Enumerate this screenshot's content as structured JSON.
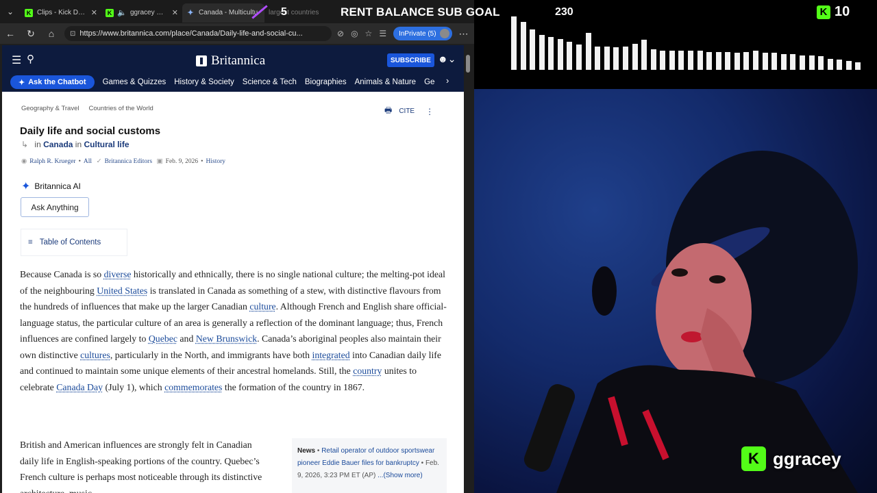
{
  "browser": {
    "tabs": [
      {
        "title": "Clips - Kick Dashbo",
        "icon": "kick-icon"
      },
      {
        "title": "ggracey Stream",
        "icon": "speaker-icon"
      },
      {
        "title": "Canada - Multicultu",
        "icon": "britannica-icon"
      },
      {
        "title": "largest countries",
        "icon": "page-icon"
      }
    ],
    "url": "https://www.britannica.com/place/Canada/Daily-life-and-social-cu...",
    "inprivate_label": "InPrivate (5)"
  },
  "site": {
    "logo": "Britannica",
    "subscribe": "SUBSCRIBE",
    "chatbot": "Ask the Chatbot",
    "nav": [
      "Games & Quizzes",
      "History & Society",
      "Science & Tech",
      "Biographies",
      "Animals & Nature",
      "Geography & Travel"
    ]
  },
  "article": {
    "breadcrumbs": [
      "Geography & Travel",
      "Countries of the World"
    ],
    "cite": "CITE",
    "title": "Daily life and social customs",
    "in_word_1": "in",
    "in_link_1": "Canada",
    "in_word_2": "in",
    "in_link_2": "Cultural life",
    "author": "Ralph R. Krueger",
    "all": "All",
    "editors": "Britannica Editors",
    "date": "Feb. 9, 2026",
    "history": "History",
    "ai_label": "Britannica AI",
    "ask_anything": "Ask Anything",
    "toc": "Table of Contents",
    "p1": [
      {
        "t": "Because Canada is so "
      },
      {
        "t": "diverse",
        "link": true
      },
      {
        "t": " historically and ethnically, there is no single national culture; the melting-pot ideal of the neighbouring "
      },
      {
        "t": "United States",
        "link": true
      },
      {
        "t": " is translated in Canada as something of a stew, with distinctive flavours from the hundreds of influences that make up the larger Canadian "
      },
      {
        "t": "culture",
        "link": true
      },
      {
        "t": ". Although French and English share official-language status, the particular culture of an area is generally a reflection of the dominant language; thus, French influences are confined largely to "
      },
      {
        "t": "Quebec",
        "link": true
      },
      {
        "t": " and "
      },
      {
        "t": "New Brunswick",
        "link": true
      },
      {
        "t": ". Canada’s aboriginal peoples also maintain their own distinctive "
      },
      {
        "t": "cultures",
        "link": true
      },
      {
        "t": ", particularly in the North, and immigrants have both "
      },
      {
        "t": "integrated",
        "link": true
      },
      {
        "t": " into Canadian daily life and continued to maintain some unique elements of their ancestral homelands. Still, the "
      },
      {
        "t": "country",
        "link": true
      },
      {
        "t": " unites to celebrate "
      },
      {
        "t": "Canada Day",
        "link": true
      },
      {
        "t": " (July 1), which "
      },
      {
        "t": "commemorates",
        "link": true
      },
      {
        "t": " the formation of the country in 1867."
      }
    ],
    "p2": "British and American influences are strongly felt in Canadian daily life in English-speaking portions of the country. Quebec’s French culture is perhaps most noticeable through its distinctive architecture, music,",
    "news_label": "News",
    "news_bullet": " • ",
    "news_text": "Retail operator of outdoor sportswear pioneer Eddie Bauer files for bankruptcy",
    "news_meta": " • Feb. 9, 2026, 3:23 PM ET (AP)",
    "news_more": "...(Show more)"
  },
  "overlay": {
    "goal_count": "5",
    "goal_title": "RENT BALANCE SUB GOAL",
    "goal_value": "230",
    "kick_count": "10",
    "streamer": "ggracey",
    "audio_bars": [
      0.95,
      0.85,
      0.72,
      0.62,
      0.58,
      0.55,
      0.5,
      0.45,
      0.66,
      0.42,
      0.42,
      0.4,
      0.42,
      0.46,
      0.54,
      0.36,
      0.34,
      0.34,
      0.34,
      0.34,
      0.34,
      0.32,
      0.32,
      0.32,
      0.3,
      0.32,
      0.34,
      0.3,
      0.3,
      0.28,
      0.28,
      0.26,
      0.26,
      0.24,
      0.2,
      0.18,
      0.16,
      0.14
    ]
  }
}
